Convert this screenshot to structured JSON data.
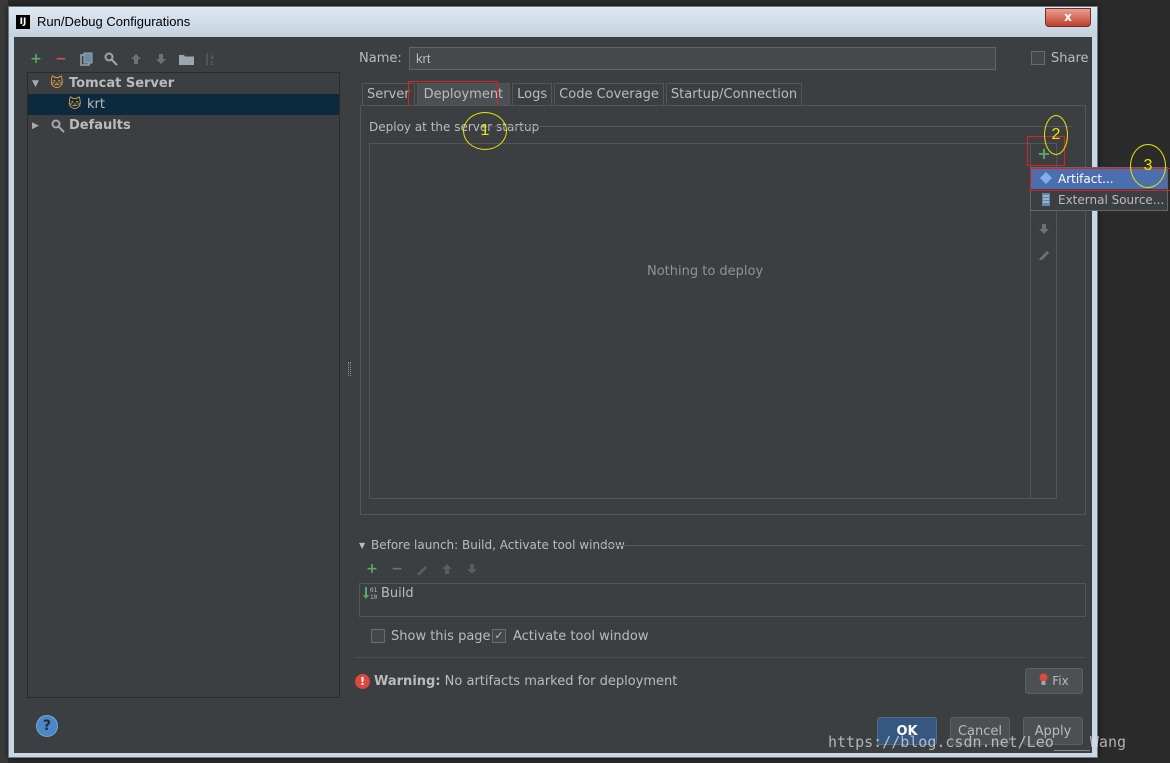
{
  "window": {
    "title": "Run/Debug Configurations",
    "app_icon": "IJ",
    "close_label": "x"
  },
  "left_toolbar": {
    "icons": [
      "add-icon",
      "remove-icon",
      "copy-icon",
      "edit-defaults-icon",
      "move-up-icon",
      "move-down-icon",
      "folder-icon",
      "sort-icon"
    ]
  },
  "tree": {
    "items": [
      {
        "label": "Tomcat Server",
        "icon": "tomcat-icon",
        "expanded": true
      },
      {
        "label": "krt",
        "icon": "tomcat-icon",
        "selected": true
      },
      {
        "label": "Defaults",
        "icon": "defaults-icon",
        "expanded": false
      }
    ]
  },
  "name": {
    "label": "Name:",
    "value": "krt"
  },
  "share": {
    "label": "Share",
    "checked": false
  },
  "tabs": [
    {
      "label": "Server"
    },
    {
      "label": "Deployment",
      "active": true
    },
    {
      "label": "Logs"
    },
    {
      "label": "Code Coverage"
    },
    {
      "label": "Startup/Connection"
    }
  ],
  "deployment": {
    "section_label": "Deploy at the server startup",
    "empty_text": "Nothing to deploy"
  },
  "popup_menu": {
    "items": [
      {
        "label": "Artifact...",
        "icon": "artifact-icon",
        "selected": true
      },
      {
        "label": "External Source...",
        "icon": "external-source-icon"
      }
    ]
  },
  "annotations": {
    "one": "1",
    "two": "2",
    "three": "3"
  },
  "before_launch": {
    "label": "Before launch: Build, Activate tool window",
    "tasks": [
      {
        "label": "Build",
        "icon": "build-icon"
      }
    ]
  },
  "options": {
    "show_page": {
      "label": "Show this page",
      "checked": false
    },
    "activate_tool_window": {
      "label": "Activate tool window",
      "checked": true
    }
  },
  "warning": {
    "prefix": "Warning:",
    "text": "No artifacts marked for deployment",
    "fix_label": "Fix"
  },
  "buttons": {
    "ok": "OK",
    "cancel": "Cancel",
    "apply": "Apply",
    "help": "?"
  },
  "watermark": "https://blog.csdn.net/Leo____Wang",
  "colors": {
    "accent": "#4b6eaf",
    "highlight_red": "#e02020",
    "annotation_yellow": "#e8e800",
    "add_green": "#59a869"
  }
}
